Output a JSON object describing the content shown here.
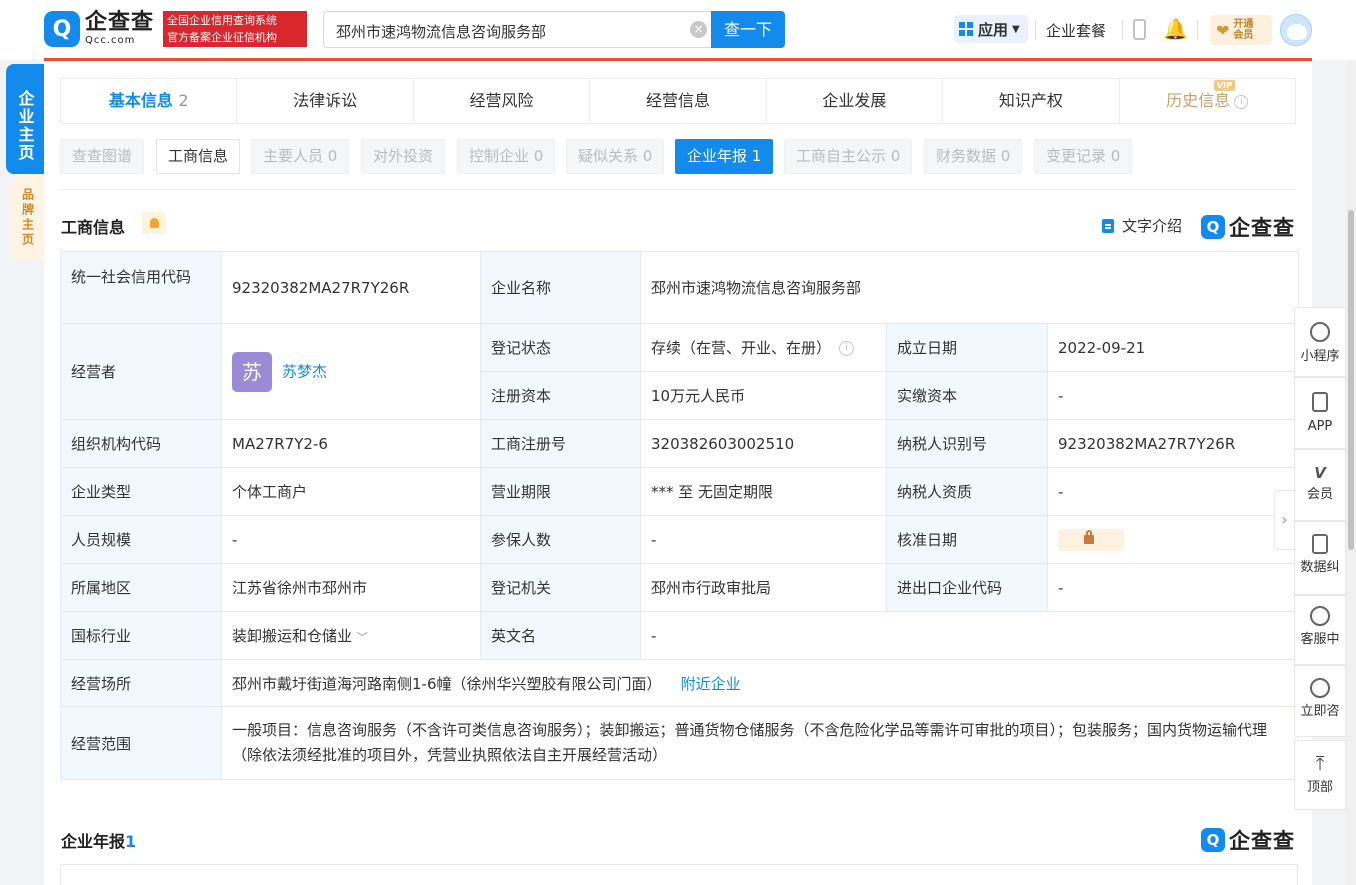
{
  "header": {
    "logo_mark": "Q",
    "logo_cn": "企查查",
    "logo_en": "Qcc.com",
    "badge_line1": "全国企业信用查询系统",
    "badge_line2": "官方备案企业征信机构",
    "search_value": "邳州市速鸿物流信息咨询服务部",
    "search_button": "查一下",
    "app_label": "应用",
    "enterprise_package": "企业套餐",
    "vip_line1": "开通",
    "vip_line2": "会员"
  },
  "side_tags": {
    "home": "企业主页",
    "brand": "品牌主页"
  },
  "tabs": [
    {
      "label": "基本信息",
      "count": "2"
    },
    {
      "label": "法律诉讼",
      "count": ""
    },
    {
      "label": "经营风险",
      "count": ""
    },
    {
      "label": "经营信息",
      "count": ""
    },
    {
      "label": "企业发展",
      "count": ""
    },
    {
      "label": "知识产权",
      "count": ""
    },
    {
      "label": "历史信息",
      "count": "",
      "badge": "VIP"
    }
  ],
  "subtabs": [
    {
      "label": "查查图谱"
    },
    {
      "label": "工商信息"
    },
    {
      "label": "主要人员 0"
    },
    {
      "label": "对外投资"
    },
    {
      "label": "控制企业 0"
    },
    {
      "label": "疑似关系 0"
    },
    {
      "label": "企业年报 1"
    },
    {
      "label": "工商自主公示 0"
    },
    {
      "label": "财务数据 0"
    },
    {
      "label": "变更记录 0"
    }
  ],
  "section": {
    "title": "工商信息",
    "doc_link": "文字介绍",
    "brand_mark": "Q",
    "brand_text": "企查查"
  },
  "info": {
    "credit_code_label": "统一社会信用代码",
    "credit_code": "92320382MA27R7Y26R",
    "name_label": "企业名称",
    "name": "邳州市速鸿物流信息咨询服务部",
    "operator_label": "经营者",
    "operator_avatar": "苏",
    "operator": "苏梦杰",
    "status_label": "登记状态",
    "status": "存续（在营、开业、在册）",
    "found_label": "成立日期",
    "found_date": "2022-09-21",
    "capital_label": "注册资本",
    "capital": "10万元人民币",
    "paid_label": "实缴资本",
    "paid": "-",
    "org_code_label": "组织机构代码",
    "org_code": "MA27R7Y2-6",
    "reg_no_label": "工商注册号",
    "reg_no": "320382603002510",
    "tax_id_label": "纳税人识别号",
    "tax_id": "92320382MA27R7Y26R",
    "type_label": "企业类型",
    "type": "个体工商户",
    "term_label": "营业期限",
    "term": "*** 至 无固定期限",
    "taxpayer_label": "纳税人资质",
    "taxpayer": "-",
    "staff_label": "人员规模",
    "staff": "-",
    "insured_label": "参保人数",
    "insured": "-",
    "approve_label": "核准日期",
    "region_label": "所属地区",
    "region": "江苏省徐州市邳州市",
    "authority_label": "登记机关",
    "authority": "邳州市行政审批局",
    "import_label": "进出口企业代码",
    "import_code": "-",
    "industry_label": "国标行业",
    "industry": "装卸搬运和仓储业",
    "english_label": "英文名",
    "english": "-",
    "address_label": "经营场所",
    "address": "邳州市戴圩街道海河路南侧1-6幢（徐州华兴塑胶有限公司门面）",
    "nearby": "附近企业",
    "scope_label": "经营范围",
    "scope": "一般项目：信息咨询服务（不含许可类信息咨询服务）；装卸搬运；普通货物仓储服务（不含危险化学品等需许可审批的项目）；包装服务；国内货物运输代理（除依法须经批准的项目外，凭营业执照依法自主开展经营活动）"
  },
  "annual_report": {
    "title": "企业年报",
    "count": "1"
  },
  "right_toolbar": [
    {
      "label": "小程序"
    },
    {
      "label": "APP"
    },
    {
      "label": "会员"
    },
    {
      "label": "数据纠错"
    },
    {
      "label": "客服中心"
    },
    {
      "label": "立即咨询"
    },
    {
      "label": "顶部"
    }
  ]
}
